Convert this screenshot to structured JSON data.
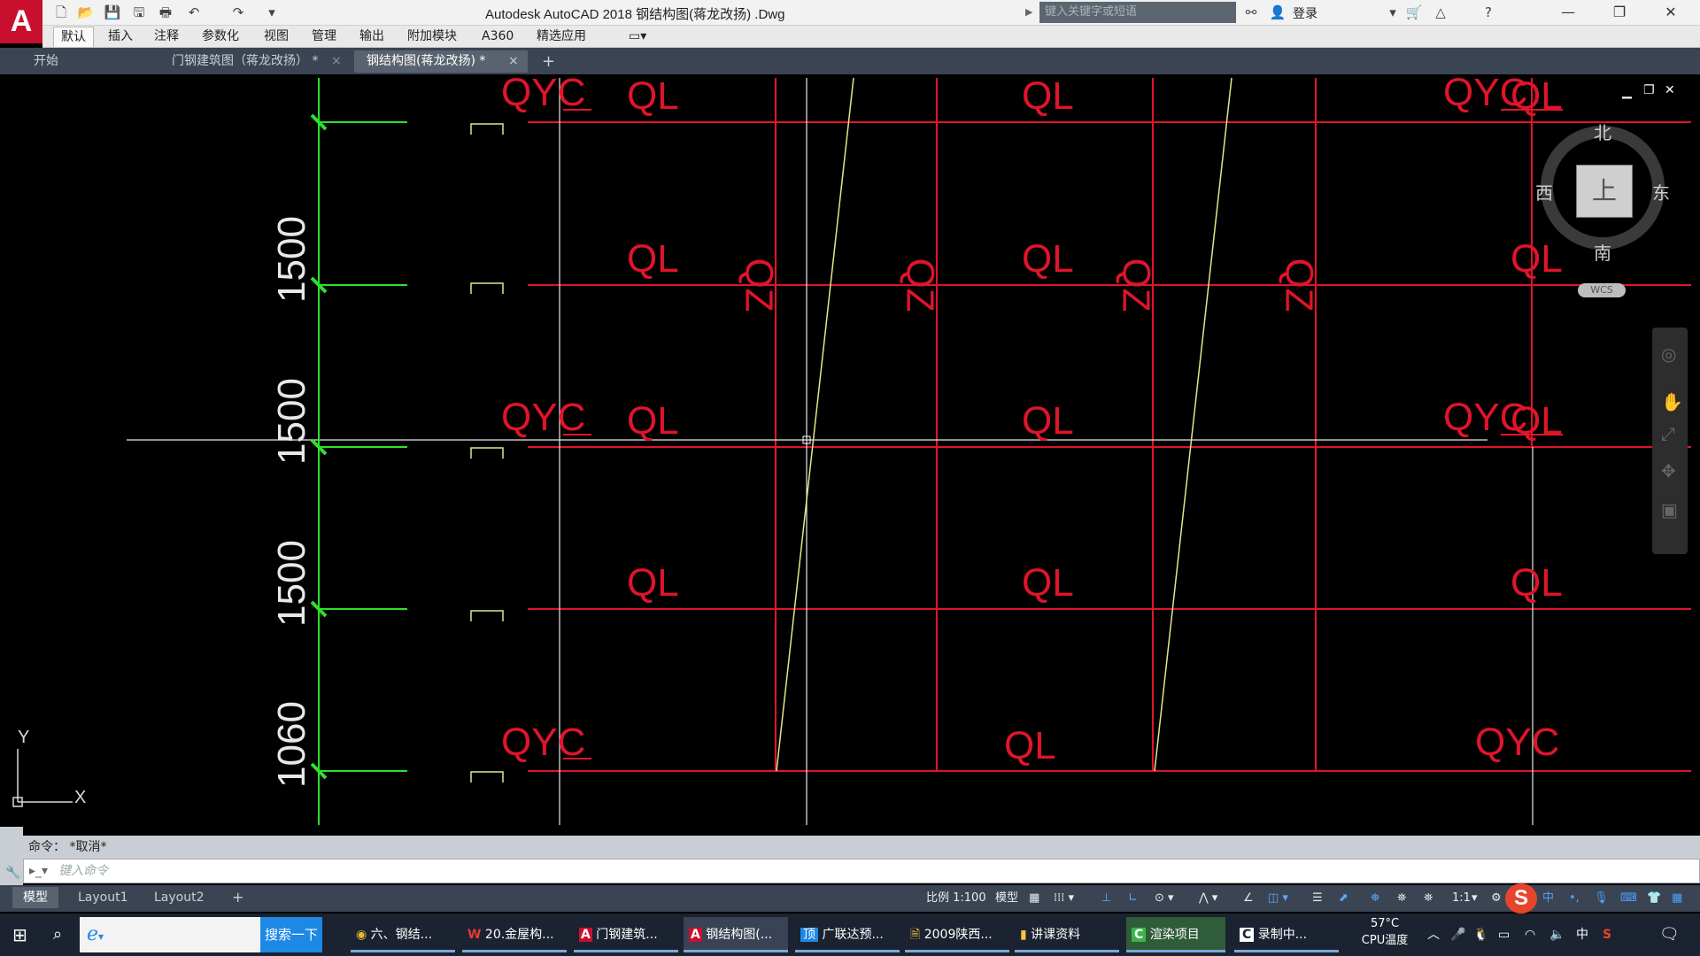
{
  "app": {
    "logo_letter": "A",
    "title": "Autodesk AutoCAD 2018    钢结构图(蒋龙改扬) .Dwg",
    "search_placeholder": "键入关键字或短语",
    "login_label": "登录"
  },
  "ribbon_tabs": [
    "默认",
    "插入",
    "注释",
    "参数化",
    "视图",
    "管理",
    "输出",
    "附加模块",
    "A360",
    "精选应用"
  ],
  "doc_tabs": [
    {
      "label": "开始"
    },
    {
      "label": "门钢建筑图（蒋龙改扬） *"
    },
    {
      "label": "钢结构图(蒋龙改扬) *"
    }
  ],
  "viewcube": {
    "north": "北",
    "south": "南",
    "east": "东",
    "west": "西",
    "face": "上",
    "wcs": "WCS"
  },
  "drawing": {
    "dimensions": [
      "1500",
      "1500",
      "1500",
      "1060"
    ],
    "labels": {
      "qyc": "QYC",
      "ql": "QL",
      "qz": "QZ"
    },
    "ucs_x": "X",
    "ucs_y": "Y"
  },
  "command": {
    "history": "命令：  *取消*",
    "placeholder": "键入命令"
  },
  "layout_tabs": [
    "模型",
    "Layout1",
    "Layout2"
  ],
  "status": {
    "scale": "比例 1:100",
    "space": "模型",
    "annotation_scale": "1:1"
  },
  "taskbar": {
    "search_button": "搜索一下",
    "items": [
      "六、钢结...",
      "20.金屋构...",
      "门钢建筑...",
      "钢结构图(...",
      "广联达预...",
      "2009陕西...",
      "讲课资料",
      "渲染项目",
      "录制中..."
    ],
    "temp": "57°C",
    "temp_label": "CPU温度",
    "ime": "中"
  },
  "colors": {
    "canvas": "#000000",
    "red_lines": "#e0142a",
    "green_axis": "#2ee02e",
    "yellow_lines": "#e6e68a",
    "accent": "#c8102e"
  }
}
